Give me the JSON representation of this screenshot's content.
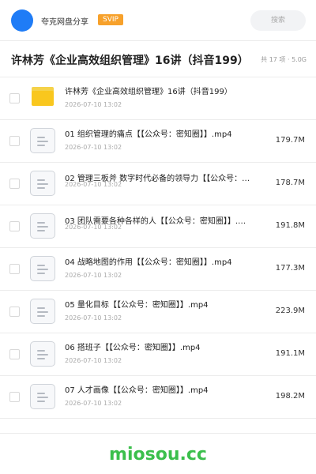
{
  "header": {
    "brand": "夸克网盘分享",
    "badge": "SVIP",
    "search_placeholder": "搜索"
  },
  "title_bar": {
    "title": "许林芳《企业高效组织管理》16讲（抖音199）",
    "summary": "共 17 项 · 5.0G"
  },
  "items": [
    {
      "type": "folder",
      "name": "许林芳《企业高效组织管理》16讲（抖音199）",
      "date": "2026-07-10 13:02",
      "size": ""
    },
    {
      "type": "file",
      "name": "01 组织管理的痛点【【公众号：密知圈】】.mp4",
      "date": "2026-07-10 13:02",
      "size": "179.7M"
    },
    {
      "type": "file",
      "name": "02 管理三板斧 数字时代必备的领导力【【公众号：…",
      "date": "2026-07-10 13:02",
      "size": "178.7M"
    },
    {
      "type": "file",
      "name": "03 团队需要各种各样的人【【公众号：密知圈】】.…",
      "date": "2026-07-10 13:02",
      "size": "191.8M"
    },
    {
      "type": "file",
      "name": "04 战略地图的作用【【公众号：密知圈】】.mp4",
      "date": "2026-07-10 13:02",
      "size": "177.3M"
    },
    {
      "type": "file",
      "name": "05 量化目标【【公众号：密知圈】】.mp4",
      "date": "2026-07-10 13:02",
      "size": "223.9M"
    },
    {
      "type": "file",
      "name": "06 搭班子【【公众号：密知圈】】.mp4",
      "date": "2026-07-10 13:02",
      "size": "191.1M"
    },
    {
      "type": "file",
      "name": "07 人才画像【【公众号：密知圈】】.mp4",
      "date": "2026-07-10 13:02",
      "size": "198.2M"
    }
  ],
  "footer": {
    "logo": "miosou.cc"
  },
  "colors": {
    "avatar": "#1f7cf6",
    "badge": "#f7a12b",
    "folder": "#f9c71e",
    "logo": "#3bbf4c"
  }
}
